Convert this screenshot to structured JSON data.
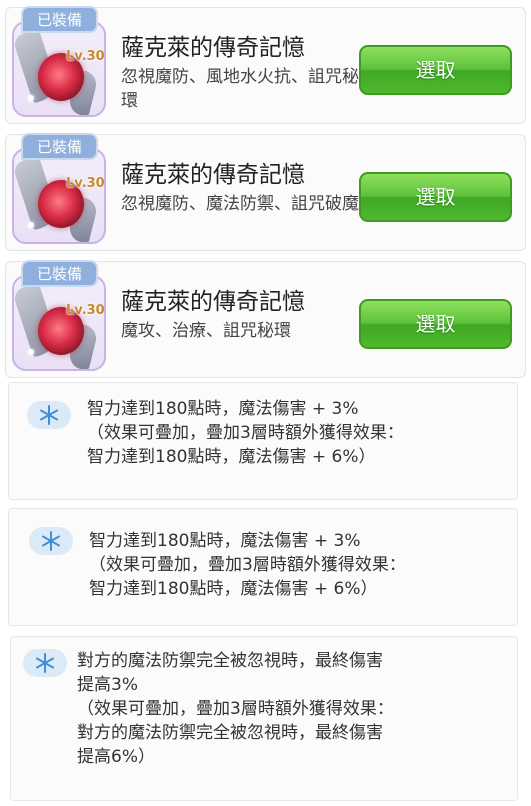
{
  "cards": [
    {
      "badge": "已裝備",
      "level": "Lv.30",
      "title": "薩克萊的傳奇記憶",
      "desc": "忽視魔防、風地水火抗、詛咒秘環",
      "button": "選取"
    },
    {
      "badge": "已裝備",
      "level": "Lv.30",
      "title": "薩克萊的傳奇記憶",
      "desc": "忽視魔防、魔法防禦、詛咒破魔",
      "button": "選取"
    },
    {
      "badge": "已裝備",
      "level": "Lv.30",
      "title": "薩克萊的傳奇記憶",
      "desc": "魔攻、治療、詛咒秘環",
      "button": "選取"
    }
  ],
  "effects": [
    {
      "icon": "snowflake-icon",
      "text": "智力達到180點時，魔法傷害 + 3%\n  （效果可疊加，疊加3層時額外獲得效果：\n智力達到180點時，魔法傷害 + 6%）"
    },
    {
      "icon": "snowflake-icon",
      "text": "智力達到180點時，魔法傷害 + 3%\n  （效果可疊加，疊加3層時額外獲得效果：\n智力達到180點時，魔法傷害 + 6%）"
    },
    {
      "icon": "snowflake-icon",
      "text": "對方的魔法防禦完全被忽視時，最終傷害\n提高3%\n  （效果可疊加，疊加3層時額外獲得效果：\n對方的魔法防禦完全被忽視時，最終傷害\n提高6%）"
    }
  ],
  "colors": {
    "button_green": "#5cc23a",
    "badge_blue": "#8fb0dd",
    "frame_purple": "#c8b3e6",
    "level_gold": "#c98a2a"
  }
}
